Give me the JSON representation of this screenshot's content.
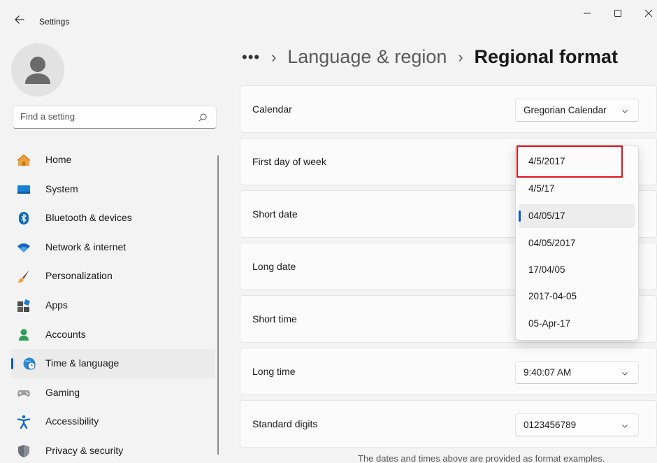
{
  "window": {
    "title": "Settings",
    "controls": {
      "minimize": "minimize-icon",
      "maximize": "maximize-icon",
      "close": "close-icon"
    }
  },
  "search": {
    "placeholder": "Find a setting",
    "value": ""
  },
  "sidebar": {
    "items": [
      {
        "label": "Home",
        "icon": "home-icon"
      },
      {
        "label": "System",
        "icon": "system-icon"
      },
      {
        "label": "Bluetooth & devices",
        "icon": "bluetooth-icon"
      },
      {
        "label": "Network & internet",
        "icon": "wifi-icon"
      },
      {
        "label": "Personalization",
        "icon": "brush-icon"
      },
      {
        "label": "Apps",
        "icon": "apps-icon"
      },
      {
        "label": "Accounts",
        "icon": "accounts-icon"
      },
      {
        "label": "Time & language",
        "icon": "globe-clock-icon",
        "active": true
      },
      {
        "label": "Gaming",
        "icon": "gamepad-icon"
      },
      {
        "label": "Accessibility",
        "icon": "accessibility-icon"
      },
      {
        "label": "Privacy & security",
        "icon": "shield-icon"
      }
    ]
  },
  "breadcrumb": {
    "more": "•••",
    "separator": "›",
    "parent": "Language & region",
    "current": "Regional format"
  },
  "settings": [
    {
      "label": "Calendar",
      "value": "Gregorian Calendar"
    },
    {
      "label": "First day of week",
      "value": ""
    },
    {
      "label": "Short date",
      "value": ""
    },
    {
      "label": "Long date",
      "value": ""
    },
    {
      "label": "Short time",
      "value": ""
    },
    {
      "label": "Long time",
      "value": "9:40:07 AM"
    },
    {
      "label": "Standard digits",
      "value": "0123456789"
    }
  ],
  "dropdown": {
    "options": [
      "4/5/2017",
      "4/5/17",
      "04/05/17",
      "04/05/2017",
      "17/04/05",
      "2017-04-05",
      "05-Apr-17"
    ],
    "selected": "04/05/17",
    "highlighted": "4/5/2017"
  },
  "footnote": "The dates and times above are provided as format examples.",
  "colors": {
    "accent": "#005fb8",
    "highlight_box": "#e0141e"
  }
}
